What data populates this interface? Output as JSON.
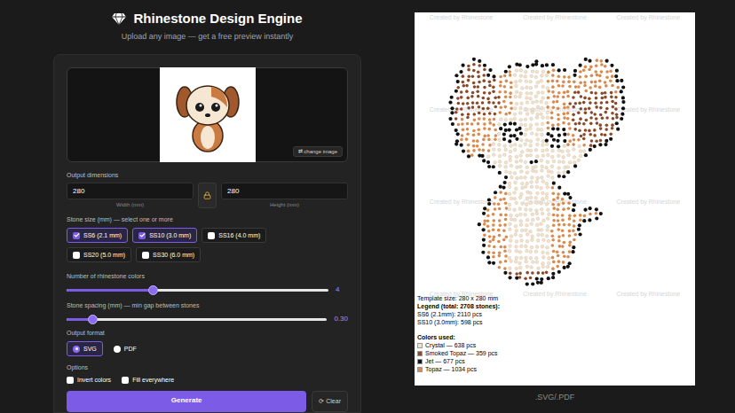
{
  "header": {
    "title": "Rhinestone Design Engine",
    "subtitle": "Upload any image — get a free preview instantly"
  },
  "upload": {
    "change_button": "⇄ change image"
  },
  "dimensions": {
    "label": "Output dimensions",
    "locked": true,
    "fields": [
      {
        "value": "280",
        "caption": "Width (mm)"
      },
      {
        "value": "280",
        "caption": "Height (mm)"
      }
    ]
  },
  "stone_sizes": {
    "label": "Stone size (mm) — select one or more",
    "options": [
      {
        "label": "SS6 (2.1 mm)",
        "checked": true
      },
      {
        "label": "SS10 (3.0 mm)",
        "checked": true
      },
      {
        "label": "SS16 (4.0 mm)",
        "checked": false
      },
      {
        "label": "SS20 (5.0 mm)",
        "checked": false
      },
      {
        "label": "SS30 (6.0 mm)",
        "checked": false
      }
    ]
  },
  "sliders": [
    {
      "label": "Number of rhinestone colors",
      "level": 0.33,
      "reading": "4"
    },
    {
      "label": "Stone spacing (mm) — min gap between stones",
      "level": 0.1,
      "reading": "0.30"
    }
  ],
  "output_format": {
    "label": "Output format",
    "options": [
      {
        "label": "SVG",
        "selected": true
      },
      {
        "label": "PDF",
        "selected": false
      }
    ]
  },
  "options": {
    "label": "Options",
    "items": [
      {
        "label": "Invert colors",
        "checked": false
      },
      {
        "label": "Fill everywhere",
        "checked": false
      }
    ]
  },
  "buttons": {
    "generate": "Generate",
    "clear": "⟳ Clear"
  },
  "preview": {
    "watermark": "Created by Rhinestone",
    "template_size": "Template size: 280 x 280 mm",
    "legend_title": "Legend (total: 2708 stones):",
    "sizes": [
      "SS6 (2.1mm): 2110 pcs",
      "SS10 (3.0mm): 598 pcs"
    ],
    "colors_title": "Colors used:",
    "colors": [
      {
        "label": "Crystal — 638 pcs",
        "color": "#f3e3cc"
      },
      {
        "label": "Smoked Topaz — 359 pcs",
        "color": "#8a4a2a"
      },
      {
        "label": "Jet — 677 pcs",
        "color": "#111111"
      },
      {
        "label": "Topaz — 1034 pcs",
        "color": "#d98a4e"
      }
    ],
    "caption": ".SVG/.PDF"
  }
}
